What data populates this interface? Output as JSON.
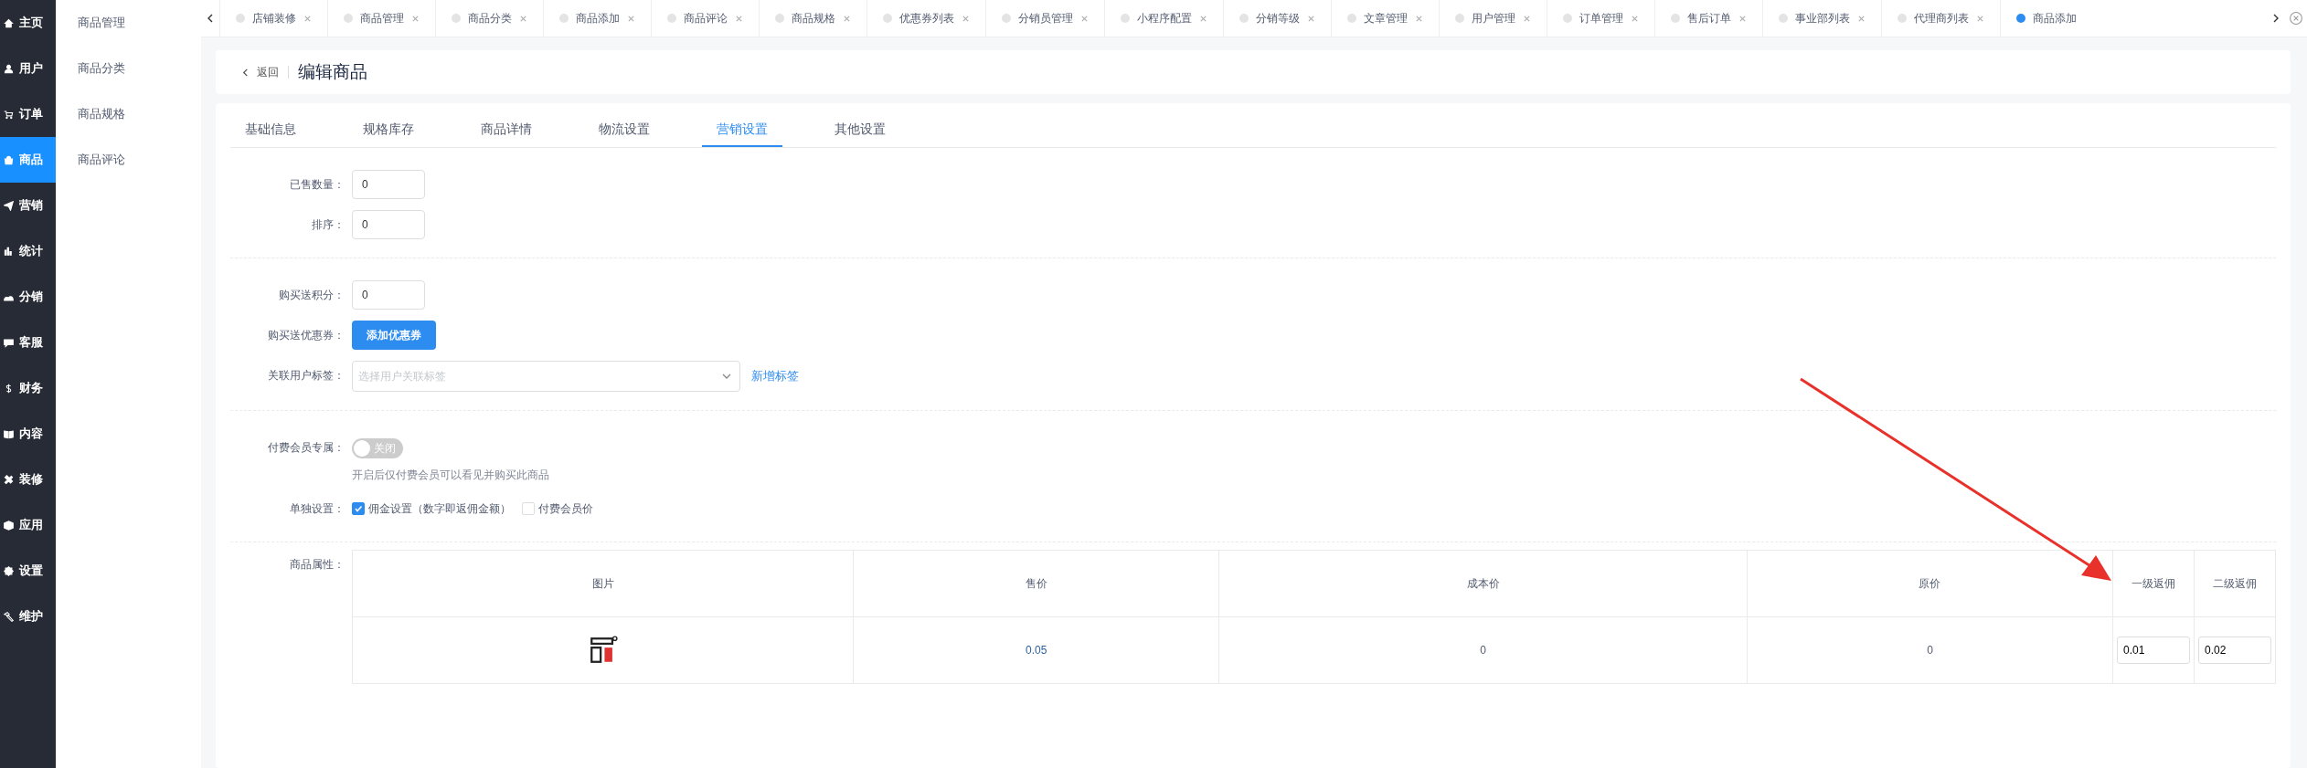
{
  "nav": [
    {
      "label": "主页",
      "selected": false
    },
    {
      "label": "用户",
      "selected": false
    },
    {
      "label": "订单",
      "selected": false
    },
    {
      "label": "商品",
      "selected": true
    },
    {
      "label": "营销",
      "selected": false
    },
    {
      "label": "统计",
      "selected": false
    },
    {
      "label": "分销",
      "selected": false
    },
    {
      "label": "客服",
      "selected": false
    },
    {
      "label": "财务",
      "selected": false
    },
    {
      "label": "内容",
      "selected": false
    },
    {
      "label": "装修",
      "selected": false
    },
    {
      "label": "应用",
      "selected": false
    },
    {
      "label": "设置",
      "selected": false
    },
    {
      "label": "维护",
      "selected": false
    }
  ],
  "submenu": [
    {
      "label": "商品管理",
      "selected": false
    },
    {
      "label": "商品分类",
      "selected": false
    },
    {
      "label": "商品规格",
      "selected": false
    },
    {
      "label": "商品评论",
      "selected": false
    }
  ],
  "page_tabs": [
    {
      "label": "店铺装修",
      "selected": false
    },
    {
      "label": "商品管理",
      "selected": false
    },
    {
      "label": "商品分类",
      "selected": false
    },
    {
      "label": "商品添加",
      "selected": false
    },
    {
      "label": "商品评论",
      "selected": false
    },
    {
      "label": "商品规格",
      "selected": false
    },
    {
      "label": "优惠券列表",
      "selected": false
    },
    {
      "label": "分销员管理",
      "selected": false
    },
    {
      "label": "小程序配置",
      "selected": false
    },
    {
      "label": "分销等级",
      "selected": false
    },
    {
      "label": "文章管理",
      "selected": false
    },
    {
      "label": "用户管理",
      "selected": false
    },
    {
      "label": "订单管理",
      "selected": false
    },
    {
      "label": "售后订单",
      "selected": false
    },
    {
      "label": "事业部列表",
      "selected": false
    },
    {
      "label": "代理商列表",
      "selected": false
    },
    {
      "label": "商品添加",
      "selected": true
    }
  ],
  "header": {
    "back": "返回",
    "title": "编辑商品"
  },
  "form_tabs": [
    {
      "label": "基础信息",
      "selected": false
    },
    {
      "label": "规格库存",
      "selected": false
    },
    {
      "label": "商品详情",
      "selected": false
    },
    {
      "label": "物流设置",
      "selected": false
    },
    {
      "label": "营销设置",
      "selected": true
    },
    {
      "label": "其他设置",
      "selected": false
    }
  ],
  "sections": [
    [
      {
        "kind": "input",
        "label": "已售数量：",
        "value": "0"
      },
      {
        "kind": "input",
        "label": "排序：",
        "value": "0"
      }
    ],
    [
      {
        "kind": "input",
        "label": "购买送积分：",
        "value": "0"
      },
      {
        "kind": "button",
        "label": "购买送优惠券：",
        "button": "添加优惠券"
      },
      {
        "kind": "select",
        "label": "关联用户标签：",
        "placeholder": "选择用户关联标签",
        "link": "新增标签"
      }
    ],
    [
      {
        "kind": "switch",
        "label": "付费会员专属：",
        "on": false,
        "text": "关闭",
        "help": "开启后仅付费会员可以看见并购买此商品"
      },
      {
        "kind": "checks",
        "label": "单独设置：",
        "options": [
          {
            "label": "佣金设置（数字即返佣金额）",
            "checked": true
          },
          {
            "label": "付费会员价",
            "checked": false
          }
        ]
      }
    ]
  ],
  "attributes": {
    "label": "商品属性：",
    "columns": [
      "图片",
      "售价",
      "成本价",
      "原价",
      "一级返佣",
      "二级返佣"
    ],
    "rows": [
      {
        "price": "0.05",
        "cost": "0",
        "original": "0",
        "level1": "0.01",
        "level2": "0.02"
      }
    ]
  }
}
